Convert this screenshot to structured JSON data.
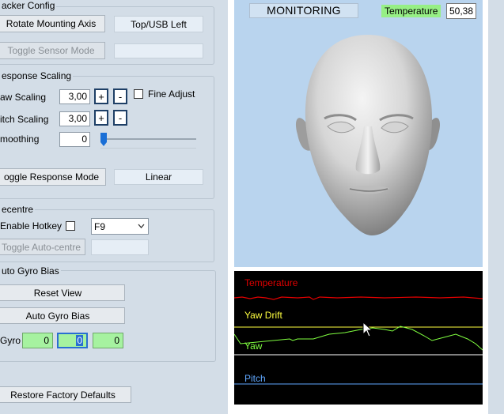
{
  "tracker_config": {
    "title": "acker Config",
    "rotate_button": "Rotate Mounting Axis",
    "mount_value": "Top/USB Left",
    "toggle_sensor_button": "Toggle Sensor Mode",
    "sensor_value": ""
  },
  "response_scaling": {
    "title": "esponse Scaling",
    "yaw_label": "aw Scaling",
    "yaw_value": "3,00",
    "pitch_label": "itch Scaling",
    "pitch_value": "3,00",
    "plus": "+",
    "minus": "-",
    "fine_adjust_label": "Fine Adjust",
    "fine_adjust_checked": false,
    "smoothing_label": "moothing",
    "smoothing_value": "0",
    "smoothing_level": 0.0,
    "toggle_response_button": "oggle Response Mode",
    "response_mode_value": "Linear"
  },
  "recentre": {
    "title": "ecentre",
    "enable_hotkey_label": "Enable Hotkey",
    "hotkey_checked": false,
    "hotkey_value": "F9",
    "toggle_autocentre_button": "Toggle Auto-centre",
    "autocentre_value": ""
  },
  "auto_gyro_bias": {
    "title": "uto Gyro Bias",
    "reset_view_button": "Reset View",
    "auto_gyro_bias_button": "Auto Gyro Bias",
    "gyro_label": "Gyro",
    "gyro_values": [
      "0",
      "0",
      "0"
    ]
  },
  "restore_button": "Restore Factory Defaults",
  "monitor": {
    "title": "MONITORING",
    "temperature_label": "Temperature",
    "temperature_value": "50,38"
  },
  "graph": {
    "labels": {
      "temperature": "Temperature",
      "yaw_drift": "Yaw Drift",
      "yaw": "Yaw",
      "pitch": "Pitch"
    },
    "colors": {
      "temperature": "#e00000",
      "yaw_drift": "#ffff40",
      "yaw": "#80ff40",
      "pitch": "#60a8ff",
      "separator": "#ffffff"
    }
  },
  "colors": {
    "panel_bg": "#d3dde7",
    "view_bg": "#b9d4ee",
    "gyro_bg": "#a6f2a0",
    "temp_label_bg": "#96ef85"
  }
}
